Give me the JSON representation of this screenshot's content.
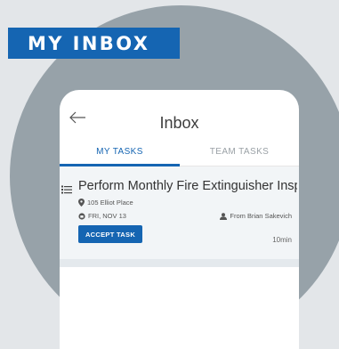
{
  "banner": {
    "title": "MY INBOX"
  },
  "app": {
    "title": "Inbox",
    "tabs": [
      {
        "label": "MY TASKS",
        "active": true
      },
      {
        "label": "TEAM TASKS",
        "active": false
      }
    ]
  },
  "task": {
    "title": "Perform Monthly Fire Extinguisher Inspec...",
    "address": "105 Elliot Place",
    "date": "FRI, NOV 13",
    "from": "From Brian Sakevich",
    "action": "ACCEPT TASK",
    "duration": "10min"
  },
  "colors": {
    "accent": "#1565b2",
    "background": "#e3e6e9",
    "circle": "#97a2a9",
    "card": "#f2f5f7"
  },
  "icons": [
    "back-arrow-icon",
    "list-icon",
    "map-pin-icon",
    "calendar-icon",
    "person-icon"
  ]
}
